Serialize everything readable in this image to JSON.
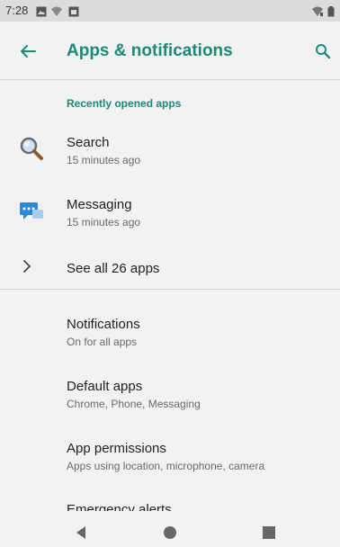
{
  "status_bar": {
    "time": "7:28"
  },
  "app_bar": {
    "title": "Apps & notifications",
    "back_icon": "arrow-left-icon",
    "search_icon": "search-icon"
  },
  "recent": {
    "header": "Recently opened apps",
    "apps": [
      {
        "name": "Search",
        "time": "15 minutes ago",
        "icon": "magnifier-app-icon"
      },
      {
        "name": "Messaging",
        "time": "15 minutes ago",
        "icon": "messaging-app-icon"
      }
    ],
    "see_all": "See all 26 apps"
  },
  "settings": [
    {
      "title": "Notifications",
      "subtitle": "On for all apps"
    },
    {
      "title": "Default apps",
      "subtitle": "Chrome, Phone, Messaging"
    },
    {
      "title": "App permissions",
      "subtitle": "Apps using location, microphone, camera"
    },
    {
      "title": "Emergency alerts",
      "subtitle": ""
    }
  ],
  "colors": {
    "accent": "#1d8a78",
    "background": "#f2f2f2",
    "status_bar": "#dcdcdc"
  }
}
